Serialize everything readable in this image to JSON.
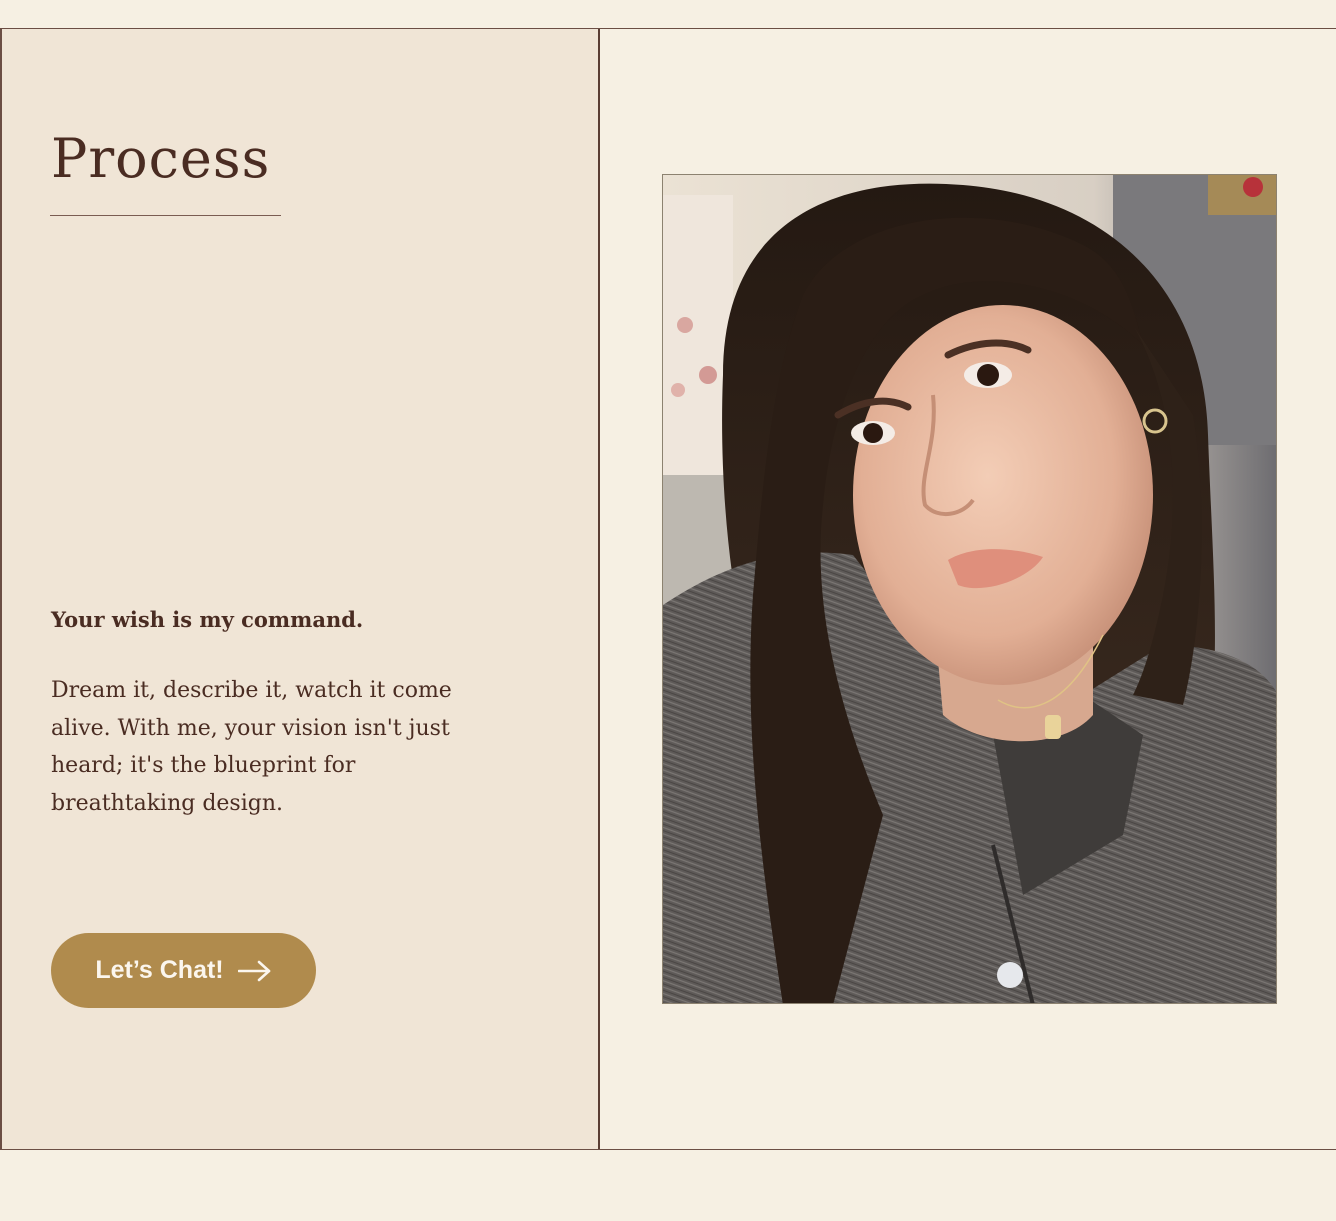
{
  "section": {
    "heading": "Process",
    "tagline": "Your wish is my command.",
    "body": "Dream it, describe it, watch it come alive. With me, your vision isn't just heard; it's the blueprint for breathtaking design.",
    "cta_label": "Let’s Chat!",
    "cta_icon": "arrow-right-icon"
  },
  "colors": {
    "page_background": "#f6f0e3",
    "panel_background": "#f0e5d6",
    "text": "#4a2c22",
    "button": "#b08b4d",
    "button_text": "#fbf6ee",
    "rule": "#6b4e44"
  }
}
